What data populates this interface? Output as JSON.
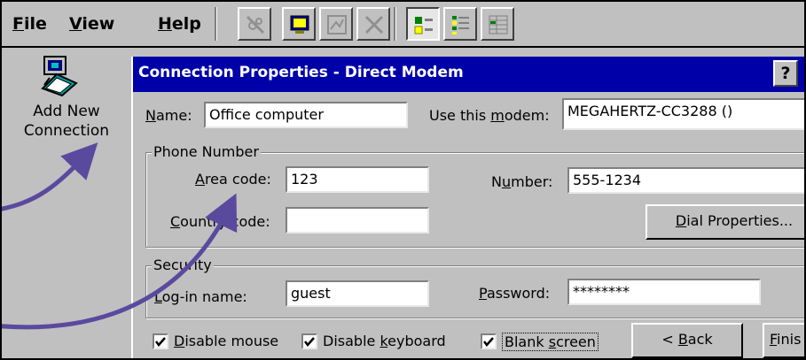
{
  "menu": {
    "file": "File",
    "view": "View",
    "help": "Help"
  },
  "toolbar": {
    "icons": [
      "connect-icon",
      "monitor-icon",
      "properties-icon",
      "delete-icon",
      "large-icons-view-icon",
      "small-icons-view-icon",
      "details-view-icon"
    ]
  },
  "desktop": {
    "add_label_line1": "Add New",
    "add_label_line2": "Connection"
  },
  "dialog": {
    "title": "Connection Properties - Direct Modem",
    "help_label": "?",
    "name_label": "Name:",
    "name_value": "Office computer",
    "modem_label": "Use this modem:",
    "modem_value": "MEGAHERTZ-CC3288 ()",
    "phone_group": "Phone Number",
    "area_label": "Area code:",
    "area_value": "123",
    "number_label": "Number:",
    "number_value": "555-1234",
    "country_label": "Country code:",
    "country_value": "",
    "dial_button": "Dial Properties...",
    "security_group": "Security",
    "login_label": "Log-in name:",
    "login_value": "guest",
    "password_label": "Password:",
    "password_value": "********",
    "disable_mouse": "Disable mouse",
    "disable_mouse_checked": true,
    "disable_keyboard": "Disable keyboard",
    "disable_keyboard_checked": true,
    "blank_screen": "Blank screen",
    "blank_screen_checked": true,
    "back_button": "< Back",
    "finish_button": "Finis"
  },
  "colors": {
    "titlebar": "#0000a8",
    "arrow": "#5a4a9e",
    "face": "#c0c0c0"
  }
}
